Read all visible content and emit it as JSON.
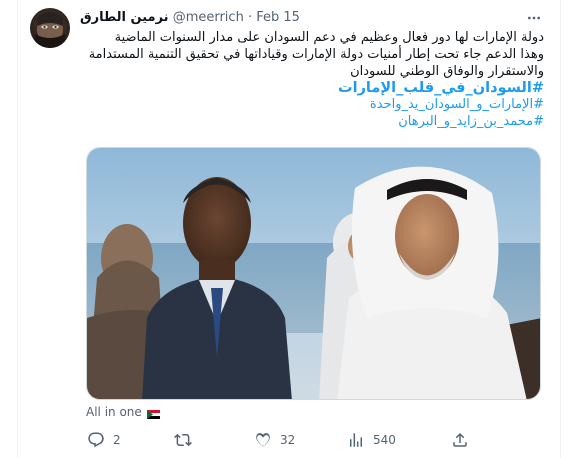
{
  "author": {
    "name": "نرمين الطارق",
    "handle": "@meerrich",
    "separator": "·",
    "date": "Feb 15"
  },
  "tweet": {
    "lines": [
      "دولة الإمارات لها دور فعال وعظيم في دعم السودان على مدار السنوات الماضية",
      "وهذا الدعم جاء تحت إطار أمنيات دولة الإمارات وقياداتها في تحقيق التنمية المستدامة",
      "والاستقرار والوفاق الوطني للسودان"
    ],
    "hashtags": [
      "#السودان_في_قلب_الإمارات",
      "#الإمارات_و_السودان_يد_واحدة",
      "#محمد_بن_زايد_و_البرهان"
    ],
    "media_caption": "All in one"
  },
  "actions": {
    "reply_count": "2",
    "retweet_count": "",
    "like_count": "32",
    "view_count": "540"
  },
  "icons": [
    "more-icon",
    "reply-icon",
    "retweet-icon",
    "like-icon",
    "views-icon",
    "share-icon",
    "sudan-flag-icon"
  ],
  "colors": {
    "accent": "#1d9bf0",
    "text": "#0f1419",
    "secondary": "#536471",
    "border": "#eff3f4"
  }
}
